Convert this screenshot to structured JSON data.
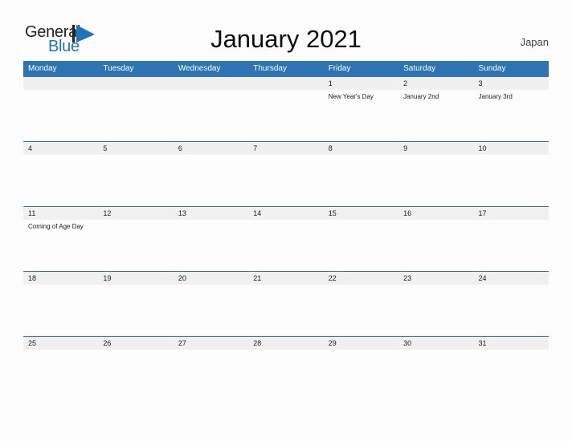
{
  "brand": {
    "name_part1": "General",
    "name_part2": "Blue",
    "flag_icon": "flag-triangle-icon",
    "flag_color": "#1d76bd"
  },
  "header": {
    "title": "January 2021",
    "country": "Japan"
  },
  "colors": {
    "header_blue": "#2e74b5",
    "date_band": "#f0f0f0",
    "page_background": "#fdfdfd",
    "brand_blue": "#1d76bd"
  },
  "calendar": {
    "weekdays": [
      "Monday",
      "Tuesday",
      "Wednesday",
      "Thursday",
      "Friday",
      "Saturday",
      "Sunday"
    ],
    "weeks": [
      {
        "days": [
          {
            "date": "",
            "event": ""
          },
          {
            "date": "",
            "event": ""
          },
          {
            "date": "",
            "event": ""
          },
          {
            "date": "",
            "event": ""
          },
          {
            "date": "1",
            "event": "New Year's Day"
          },
          {
            "date": "2",
            "event": "January 2nd"
          },
          {
            "date": "3",
            "event": "January 3rd"
          }
        ]
      },
      {
        "days": [
          {
            "date": "4",
            "event": ""
          },
          {
            "date": "5",
            "event": ""
          },
          {
            "date": "6",
            "event": ""
          },
          {
            "date": "7",
            "event": ""
          },
          {
            "date": "8",
            "event": ""
          },
          {
            "date": "9",
            "event": ""
          },
          {
            "date": "10",
            "event": ""
          }
        ]
      },
      {
        "days": [
          {
            "date": "11",
            "event": "Coming of Age Day"
          },
          {
            "date": "12",
            "event": ""
          },
          {
            "date": "13",
            "event": ""
          },
          {
            "date": "14",
            "event": ""
          },
          {
            "date": "15",
            "event": ""
          },
          {
            "date": "16",
            "event": ""
          },
          {
            "date": "17",
            "event": ""
          }
        ]
      },
      {
        "days": [
          {
            "date": "18",
            "event": ""
          },
          {
            "date": "19",
            "event": ""
          },
          {
            "date": "20",
            "event": ""
          },
          {
            "date": "21",
            "event": ""
          },
          {
            "date": "22",
            "event": ""
          },
          {
            "date": "23",
            "event": ""
          },
          {
            "date": "24",
            "event": ""
          }
        ]
      },
      {
        "days": [
          {
            "date": "25",
            "event": ""
          },
          {
            "date": "26",
            "event": ""
          },
          {
            "date": "27",
            "event": ""
          },
          {
            "date": "28",
            "event": ""
          },
          {
            "date": "29",
            "event": ""
          },
          {
            "date": "30",
            "event": ""
          },
          {
            "date": "31",
            "event": ""
          }
        ]
      }
    ]
  }
}
